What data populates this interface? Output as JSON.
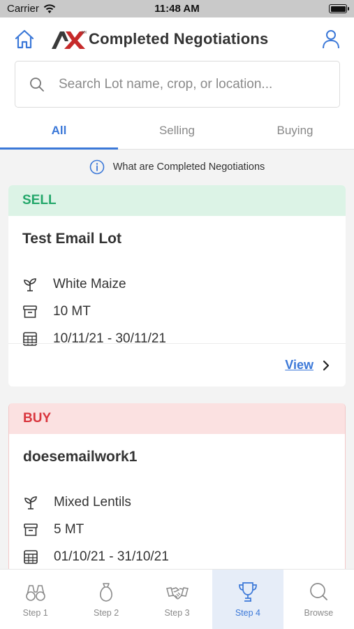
{
  "status_bar": {
    "carrier": "Carrier",
    "time": "11:48 AM"
  },
  "header": {
    "title": "Completed Negotiations",
    "icons": {
      "home": "home-icon",
      "profile": "user-icon"
    }
  },
  "search": {
    "placeholder": "Search Lot name, crop, or location...",
    "value": ""
  },
  "tabs": [
    {
      "label": "All",
      "active": true
    },
    {
      "label": "Selling",
      "active": false
    },
    {
      "label": "Buying",
      "active": false
    }
  ],
  "info": {
    "text": "What are Completed Negotiations"
  },
  "cards": [
    {
      "type_label": "SELL",
      "lot_name": "Test Email Lot",
      "crop": "White Maize",
      "quantity": "10 MT",
      "dates": "10/11/21 - 30/11/21",
      "view_label": "View"
    },
    {
      "type_label": "BUY",
      "lot_name": "doesemailwork1",
      "crop": "Mixed Lentils",
      "quantity": "5 MT",
      "dates": "01/10/21 - 31/10/21"
    }
  ],
  "bottom_nav": [
    {
      "label": "Step 1",
      "icon": "binoculars-icon"
    },
    {
      "label": "Step 2",
      "icon": "money-bag-icon"
    },
    {
      "label": "Step 3",
      "icon": "handshake-icon"
    },
    {
      "label": "Step 4",
      "icon": "trophy-icon",
      "active": true
    },
    {
      "label": "Browse",
      "icon": "search-icon"
    }
  ],
  "colors": {
    "accent": "#3b78d8",
    "sell": "#23a76a",
    "buy": "#d9363e"
  }
}
